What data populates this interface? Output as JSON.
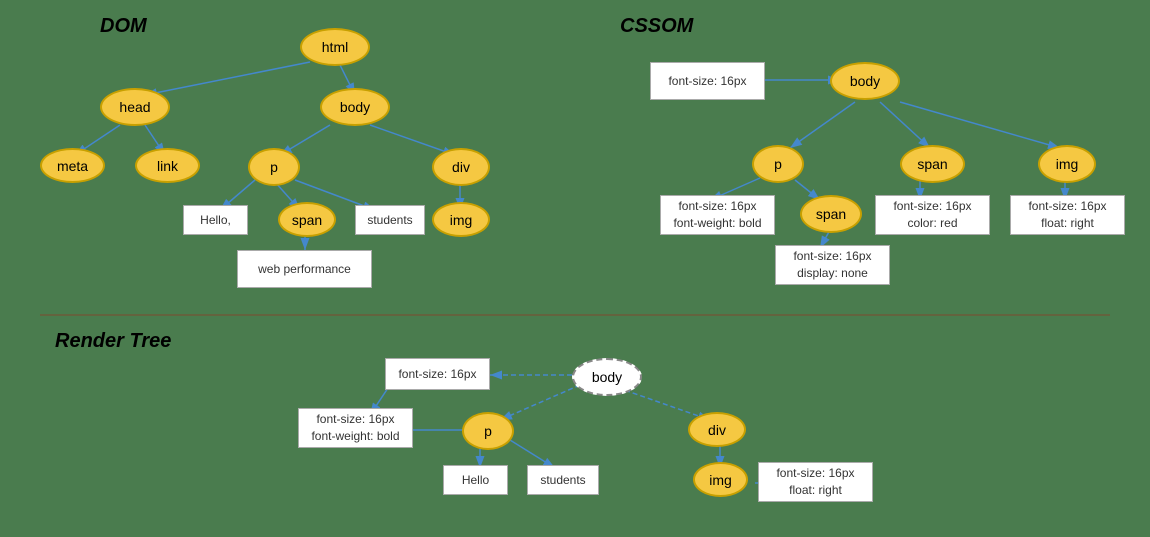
{
  "sections": {
    "dom_label": "DOM",
    "cssom_label": "CSSOM",
    "render_label": "Render Tree"
  },
  "dom_nodes": {
    "html": "html",
    "head": "head",
    "body": "body",
    "meta": "meta",
    "link": "link",
    "p": "p",
    "div": "div",
    "span": "span",
    "img_dom": "img",
    "hello": "Hello,",
    "students_dom": "students",
    "web_performance": "web performance"
  },
  "cssom_nodes": {
    "body": "body",
    "font_size_body": "font-size: 16px",
    "p": "p",
    "span_cssom": "span",
    "img_cssom": "img",
    "font_p": "font-size: 16px\nfont-weight: bold",
    "span_inner": "span",
    "font_span": "font-size: 16px\ncolor: red",
    "font_img": "font-size: 16px\nfloat: right",
    "font_span_inner": "font-size: 16px\ndisplay: none"
  },
  "render_nodes": {
    "body": "body",
    "font_size_box": "font-size: 16px",
    "p": "p",
    "div": "div",
    "img": "img",
    "font_p": "font-size: 16px\nfont-weight: bold",
    "hello": "Hello",
    "students": "students",
    "font_img": "font-size: 16px\nfloat: right"
  }
}
